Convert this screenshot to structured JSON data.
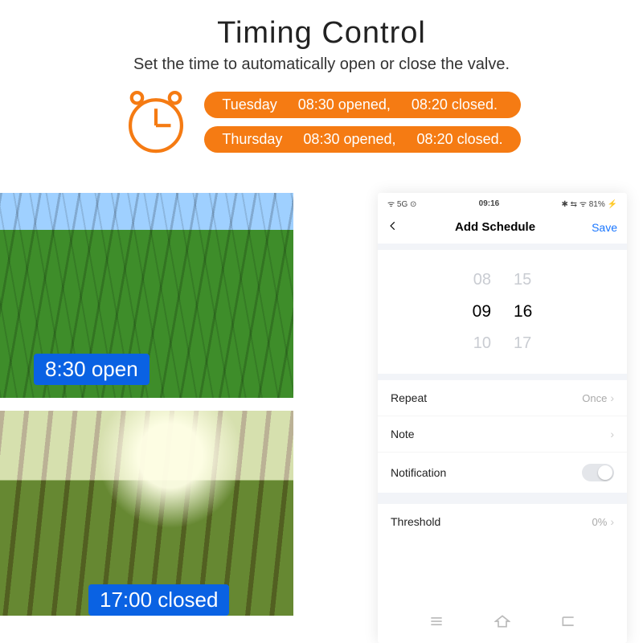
{
  "hero": {
    "title": "Timing Control",
    "subtitle": "Set the time to automatically open or close the valve."
  },
  "schedule": [
    {
      "day": "Tuesday",
      "open": "08:30 opened,",
      "close": "08:20  closed."
    },
    {
      "day": "Thursday",
      "open": "08:30 opened,",
      "close": "08:20  closed."
    }
  ],
  "photos": {
    "open_badge": "8:30 open",
    "close_badge": "17:00 closed"
  },
  "phone": {
    "status": {
      "left": "ᯤ 5G ⊙",
      "time": "09:16",
      "right": "✱ ⇆ ᯤ 81% ⚡"
    },
    "nav": {
      "title": "Add Schedule",
      "save": "Save"
    },
    "picker": {
      "rows": [
        {
          "h": "08",
          "m": "15"
        },
        {
          "h": "09",
          "m": "16"
        },
        {
          "h": "10",
          "m": "17"
        }
      ],
      "selected": 1
    },
    "rows": {
      "repeat": {
        "label": "Repeat",
        "value": "Once"
      },
      "note": {
        "label": "Note",
        "value": ""
      },
      "notification": {
        "label": "Notification",
        "on": false
      },
      "threshold": {
        "label": "Threshold",
        "value": "0%"
      }
    }
  }
}
